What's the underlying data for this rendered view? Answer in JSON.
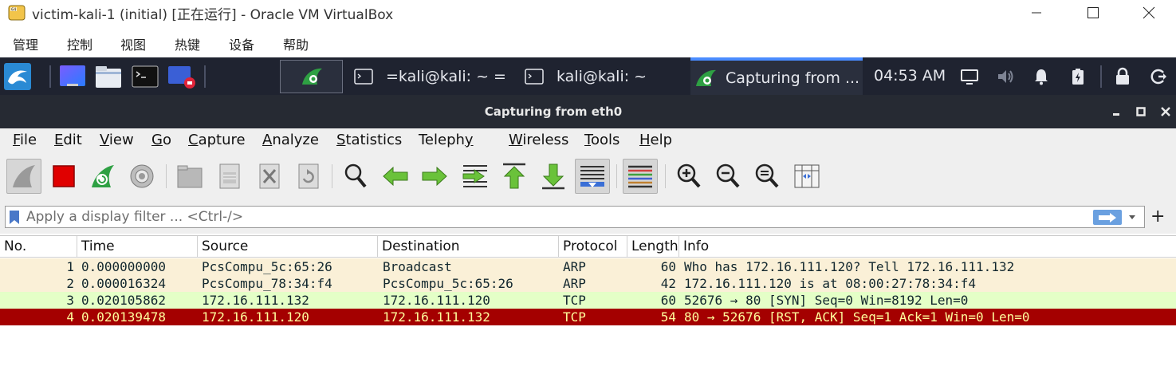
{
  "vbox": {
    "title": "victim-kali-1 (initial) [正在运行] - Oracle VM VirtualBox",
    "menu": [
      "管理",
      "控制",
      "视图",
      "热键",
      "设备",
      "帮助"
    ]
  },
  "panel": {
    "tasks": [
      {
        "label": "",
        "icon": "wireshark-icon"
      },
      {
        "label": "=kali@kali: ~ =",
        "icon": "terminal-icon"
      },
      {
        "label": "kali@kali: ~",
        "icon": "terminal-icon"
      },
      {
        "label": "Capturing from ...",
        "icon": "wireshark-icon"
      }
    ],
    "clock": "04:53 AM"
  },
  "wireshark": {
    "title": "Capturing from eth0",
    "menu": [
      {
        "label": "File",
        "u": "F",
        "rest": "ile"
      },
      {
        "label": "Edit",
        "u": "E",
        "rest": "dit"
      },
      {
        "label": "View",
        "u": "V",
        "rest": "iew"
      },
      {
        "label": "Go",
        "u": "G",
        "rest": "o"
      },
      {
        "label": "Capture",
        "u": "C",
        "rest": "apture"
      },
      {
        "label": "Analyze",
        "u": "A",
        "rest": "nalyze"
      },
      {
        "label": "Statistics",
        "u": "S",
        "rest": "tatistics"
      },
      {
        "label": "Telephony",
        "u": "y",
        "pre": "Teleph",
        "rest": ""
      },
      {
        "label": "Wireless",
        "u": "W",
        "rest": "ireless"
      },
      {
        "label": "Tools",
        "u": "T",
        "rest": "ools"
      },
      {
        "label": "Help",
        "u": "H",
        "rest": "elp"
      }
    ],
    "filter": {
      "placeholder": "Apply a display filter ... <Ctrl-/>",
      "add_label": "+"
    },
    "columns": [
      "No.",
      "Time",
      "Source",
      "Destination",
      "Protocol",
      "Length",
      "Info"
    ],
    "packets": [
      {
        "no": "1",
        "time": "0.000000000",
        "source": "PcsCompu_5c:65:26",
        "destination": "Broadcast",
        "protocol": "ARP",
        "length": "60",
        "info": "Who has 172.16.111.120? Tell 172.16.111.132",
        "color": "arp"
      },
      {
        "no": "2",
        "time": "0.000016324",
        "source": "PcsCompu_78:34:f4",
        "destination": "PcsCompu_5c:65:26",
        "protocol": "ARP",
        "length": "42",
        "info": "172.16.111.120 is at 08:00:27:78:34:f4",
        "color": "arp"
      },
      {
        "no": "3",
        "time": "0.020105862",
        "source": "172.16.111.132",
        "destination": "172.16.111.120",
        "protocol": "TCP",
        "length": "60",
        "info": "52676 → 80 [SYN] Seq=0 Win=8192 Len=0",
        "color": "tcp"
      },
      {
        "no": "4",
        "time": "0.020139478",
        "source": "172.16.111.120",
        "destination": "172.16.111.132",
        "protocol": "TCP",
        "length": "54",
        "info": "80 → 52676 [RST, ACK] Seq=1 Ack=1 Win=0 Len=0",
        "color": "rst"
      }
    ]
  }
}
